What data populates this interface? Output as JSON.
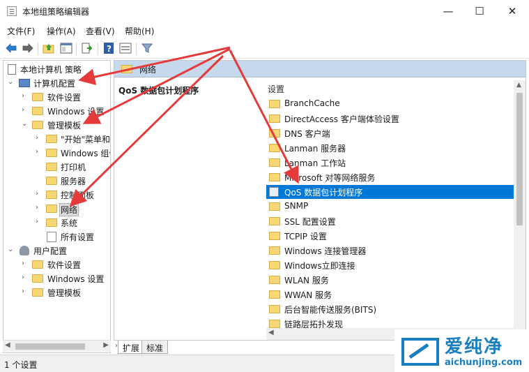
{
  "window": {
    "title": "本地组策略编辑器",
    "controls": {
      "minimize": "—",
      "maximize": "☐",
      "close": "✕"
    }
  },
  "menu": [
    "文件(F)",
    "操作(A)",
    "查看(V)",
    "帮助(H)"
  ],
  "toolbar": [
    "back-icon",
    "forward-icon",
    "up-folder-icon",
    "show-hide-tree-icon",
    "export-icon",
    "help-icon",
    "properties-icon",
    "filter-icon"
  ],
  "tree": {
    "root": "本地计算机 策略",
    "computer_config": "计算机配置",
    "software_settings": "软件设置",
    "windows_settings": "Windows 设置",
    "admin_templates": "管理模板",
    "start_menu": "\"开始\"菜单和",
    "windows_components": "Windows 组件",
    "printers": "打印机",
    "server": "服务器",
    "control_panel": "控制面板",
    "network": "网络",
    "system": "系统",
    "all_settings": "所有设置",
    "user_config": "用户配置",
    "user_software_settings": "软件设置",
    "user_windows_settings": "Windows 设置",
    "user_admin_templates": "管理模板"
  },
  "detail": {
    "header": "网络",
    "description_title": "QoS 数据包计划程序",
    "column_header": "设置",
    "items": [
      "BranchCache",
      "DirectAccess 客户端体验设置",
      "DNS 客户端",
      "Lanman 服务器",
      "Lanman 工作站",
      "Microsoft 对等网络服务",
      "QoS 数据包计划程序",
      "SNMP",
      "SSL 配置设置",
      "TCPIP 设置",
      "Windows 连接管理器",
      "Windows立即连接",
      "WLAN 服务",
      "WWAN 服务",
      "后台智能传送服务(BITS)",
      "链路层拓扑发现"
    ],
    "selected_item": "QoS 数据包计划程序"
  },
  "tabs": [
    "扩展",
    "标准"
  ],
  "status": "1 个设置",
  "colors": {
    "selection": "#0078d7",
    "header_band": "#c6d9ec",
    "annotation_arrow": "#e53a3a",
    "watermark": "#1a7fc0"
  },
  "watermark": {
    "brand": "爱纯净",
    "url": "aichunjing.com"
  }
}
